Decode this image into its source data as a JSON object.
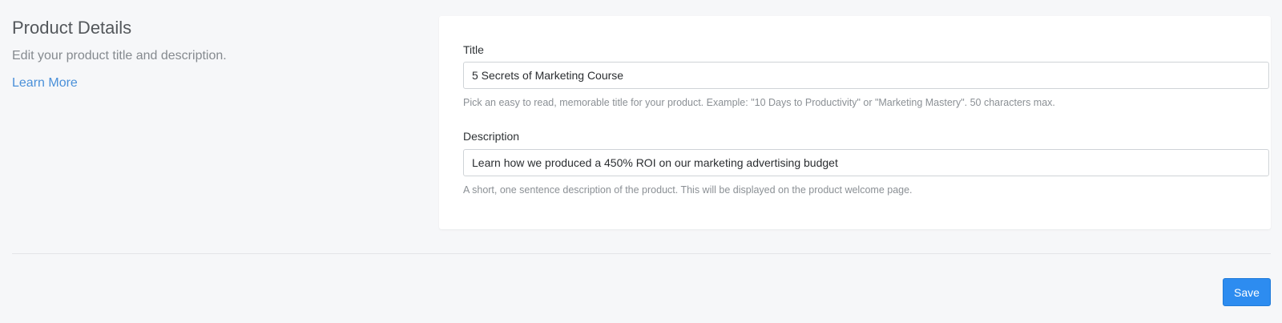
{
  "section": {
    "title": "Product Details",
    "description": "Edit your product title and description.",
    "learn_more": "Learn More"
  },
  "form": {
    "title": {
      "label": "Title",
      "value": "5 Secrets of Marketing Course",
      "help": "Pick an easy to read, memorable title for your product. Example: \"10 Days to Productivity\" or \"Marketing Mastery\". 50 characters max."
    },
    "description": {
      "label": "Description",
      "value": "Learn how we produced a 450% ROI on our marketing advertising budget",
      "help": "A short, one sentence description of the product. This will be displayed on the product welcome page."
    }
  },
  "actions": {
    "save_label": "Save"
  },
  "colors": {
    "accent": "#2d8cf0",
    "link": "#4a90d9",
    "page_background": "#f6f7f9"
  }
}
